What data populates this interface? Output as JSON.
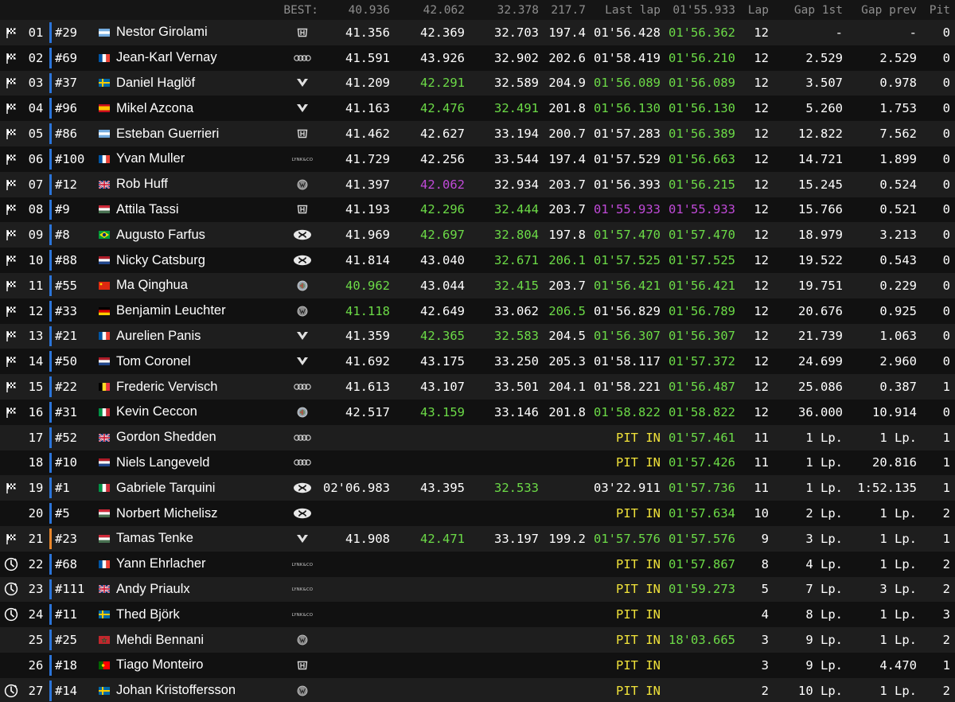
{
  "header": {
    "best_label": "BEST:",
    "best_s1": "40.936",
    "best_s2": "42.062",
    "best_s3": "32.378",
    "best_speed": "217.7",
    "last_lap_label": "Last lap",
    "best_lap": "01'55.933",
    "lap_label": "Lap",
    "gap_first_label": "Gap 1st",
    "gap_prev_label": "Gap prev",
    "pit_label": "Pit"
  },
  "colors": {
    "purple": "#c04ad8",
    "green": "#6cdb47",
    "yellow": "#f0e23a",
    "position_bar_blue": "#2a74d9",
    "position_bar_orange": "#e8862c"
  },
  "rows": [
    {
      "status": "checkered-flag-icon",
      "pos": "01",
      "num": "#29",
      "flag": "argentina",
      "name": "Nestor Girolami",
      "make": "honda-logo",
      "s1": "41.356",
      "s1c": "white",
      "s2": "42.369",
      "s2c": "white",
      "s3": "32.703",
      "s3c": "white",
      "spd": "197.4",
      "spdc": "white",
      "last": "01'56.428",
      "lastc": "white",
      "best": "01'56.362",
      "bestc": "green",
      "lap": "12",
      "gap1": "-",
      "gapp": "-",
      "pit": "0"
    },
    {
      "status": "checkered-flag-icon",
      "pos": "02",
      "num": "#69",
      "flag": "france",
      "name": "Jean-Karl Vernay",
      "make": "audi-logo",
      "s1": "41.591",
      "s1c": "white",
      "s2": "43.926",
      "s2c": "white",
      "s3": "32.902",
      "s3c": "white",
      "spd": "202.6",
      "spdc": "white",
      "last": "01'58.419",
      "lastc": "white",
      "best": "01'56.210",
      "bestc": "green",
      "lap": "12",
      "gap1": "2.529",
      "gapp": "2.529",
      "pit": "0"
    },
    {
      "status": "checkered-flag-icon",
      "pos": "03",
      "num": "#37",
      "flag": "sweden",
      "name": "Daniel Haglöf",
      "make": "cupra-logo",
      "s1": "41.209",
      "s1c": "white",
      "s2": "42.291",
      "s2c": "green",
      "s3": "32.589",
      "s3c": "white",
      "spd": "204.9",
      "spdc": "white",
      "last": "01'56.089",
      "lastc": "green",
      "best": "01'56.089",
      "bestc": "green",
      "lap": "12",
      "gap1": "3.507",
      "gapp": "0.978",
      "pit": "0"
    },
    {
      "status": "checkered-flag-icon",
      "pos": "04",
      "num": "#96",
      "flag": "spain",
      "name": "Mikel Azcona",
      "make": "cupra-logo",
      "s1": "41.163",
      "s1c": "white",
      "s2": "42.476",
      "s2c": "green",
      "s3": "32.491",
      "s3c": "green",
      "spd": "201.8",
      "spdc": "white",
      "last": "01'56.130",
      "lastc": "green",
      "best": "01'56.130",
      "bestc": "green",
      "lap": "12",
      "gap1": "5.260",
      "gapp": "1.753",
      "pit": "0"
    },
    {
      "status": "checkered-flag-icon",
      "pos": "05",
      "num": "#86",
      "flag": "argentina",
      "name": "Esteban Guerrieri",
      "make": "honda-logo",
      "s1": "41.462",
      "s1c": "white",
      "s2": "42.627",
      "s2c": "white",
      "s3": "33.194",
      "s3c": "white",
      "spd": "200.7",
      "spdc": "white",
      "last": "01'57.283",
      "lastc": "white",
      "best": "01'56.389",
      "bestc": "green",
      "lap": "12",
      "gap1": "12.822",
      "gapp": "7.562",
      "pit": "0"
    },
    {
      "status": "checkered-flag-icon",
      "pos": "06",
      "num": "#100",
      "flag": "france",
      "name": "Yvan Muller",
      "make": "lynkco-logo",
      "s1": "41.729",
      "s1c": "white",
      "s2": "42.256",
      "s2c": "white",
      "s3": "33.544",
      "s3c": "white",
      "spd": "197.4",
      "spdc": "white",
      "last": "01'57.529",
      "lastc": "white",
      "best": "01'56.663",
      "bestc": "green",
      "lap": "12",
      "gap1": "14.721",
      "gapp": "1.899",
      "pit": "0"
    },
    {
      "status": "checkered-flag-icon",
      "pos": "07",
      "num": "#12",
      "flag": "uk",
      "name": "Rob Huff",
      "make": "vw-logo",
      "s1": "41.397",
      "s1c": "white",
      "s2": "42.062",
      "s2c": "purple",
      "s3": "32.934",
      "s3c": "white",
      "spd": "203.7",
      "spdc": "white",
      "last": "01'56.393",
      "lastc": "white",
      "best": "01'56.215",
      "bestc": "green",
      "lap": "12",
      "gap1": "15.245",
      "gapp": "0.524",
      "pit": "0"
    },
    {
      "status": "checkered-flag-icon",
      "pos": "08",
      "num": "#9",
      "flag": "hungary",
      "name": "Attila Tassi",
      "make": "honda-logo",
      "s1": "41.193",
      "s1c": "white",
      "s2": "42.296",
      "s2c": "green",
      "s3": "32.444",
      "s3c": "green",
      "spd": "203.7",
      "spdc": "white",
      "last": "01'55.933",
      "lastc": "purple",
      "best": "01'55.933",
      "bestc": "purple",
      "lap": "12",
      "gap1": "15.766",
      "gapp": "0.521",
      "pit": "0"
    },
    {
      "status": "checkered-flag-icon",
      "pos": "09",
      "num": "#8",
      "flag": "brazil",
      "name": "Augusto Farfus",
      "make": "hyundai-logo",
      "s1": "41.969",
      "s1c": "white",
      "s2": "42.697",
      "s2c": "green",
      "s3": "32.804",
      "s3c": "green",
      "spd": "197.8",
      "spdc": "white",
      "last": "01'57.470",
      "lastc": "green",
      "best": "01'57.470",
      "bestc": "green",
      "lap": "12",
      "gap1": "18.979",
      "gapp": "3.213",
      "pit": "0"
    },
    {
      "status": "checkered-flag-icon",
      "pos": "10",
      "num": "#88",
      "flag": "netherlands",
      "name": "Nicky Catsburg",
      "make": "hyundai-logo",
      "s1": "41.814",
      "s1c": "white",
      "s2": "43.040",
      "s2c": "white",
      "s3": "32.671",
      "s3c": "green",
      "spd": "206.1",
      "spdc": "green",
      "last": "01'57.525",
      "lastc": "green",
      "best": "01'57.525",
      "bestc": "green",
      "lap": "12",
      "gap1": "19.522",
      "gapp": "0.543",
      "pit": "0"
    },
    {
      "status": "checkered-flag-icon",
      "pos": "11",
      "num": "#55",
      "flag": "china",
      "name": "Ma Qinghua",
      "make": "alfa-logo",
      "s1": "40.962",
      "s1c": "green",
      "s2": "43.044",
      "s2c": "white",
      "s3": "32.415",
      "s3c": "green",
      "spd": "203.7",
      "spdc": "white",
      "last": "01'56.421",
      "lastc": "green",
      "best": "01'56.421",
      "bestc": "green",
      "lap": "12",
      "gap1": "19.751",
      "gapp": "0.229",
      "pit": "0"
    },
    {
      "status": "checkered-flag-icon",
      "pos": "12",
      "num": "#33",
      "flag": "germany",
      "name": "Benjamin Leuchter",
      "make": "vw-logo",
      "s1": "41.118",
      "s1c": "green",
      "s2": "42.649",
      "s2c": "white",
      "s3": "33.062",
      "s3c": "white",
      "spd": "206.5",
      "spdc": "green",
      "last": "01'56.829",
      "lastc": "white",
      "best": "01'56.789",
      "bestc": "green",
      "lap": "12",
      "gap1": "20.676",
      "gapp": "0.925",
      "pit": "0"
    },
    {
      "status": "checkered-flag-icon",
      "pos": "13",
      "num": "#21",
      "flag": "france",
      "name": "Aurelien Panis",
      "make": "cupra-logo",
      "s1": "41.359",
      "s1c": "white",
      "s2": "42.365",
      "s2c": "green",
      "s3": "32.583",
      "s3c": "green",
      "spd": "204.5",
      "spdc": "white",
      "last": "01'56.307",
      "lastc": "green",
      "best": "01'56.307",
      "bestc": "green",
      "lap": "12",
      "gap1": "21.739",
      "gapp": "1.063",
      "pit": "0"
    },
    {
      "status": "checkered-flag-icon",
      "pos": "14",
      "num": "#50",
      "flag": "netherlands",
      "name": "Tom Coronel",
      "make": "cupra-logo",
      "s1": "41.692",
      "s1c": "white",
      "s2": "43.175",
      "s2c": "white",
      "s3": "33.250",
      "s3c": "white",
      "spd": "205.3",
      "spdc": "white",
      "last": "01'58.117",
      "lastc": "white",
      "best": "01'57.372",
      "bestc": "green",
      "lap": "12",
      "gap1": "24.699",
      "gapp": "2.960",
      "pit": "0"
    },
    {
      "status": "checkered-flag-icon",
      "pos": "15",
      "num": "#22",
      "flag": "belgium",
      "name": "Frederic Vervisch",
      "make": "audi-logo",
      "s1": "41.613",
      "s1c": "white",
      "s2": "43.107",
      "s2c": "white",
      "s3": "33.501",
      "s3c": "white",
      "spd": "204.1",
      "spdc": "white",
      "last": "01'58.221",
      "lastc": "white",
      "best": "01'56.487",
      "bestc": "green",
      "lap": "12",
      "gap1": "25.086",
      "gapp": "0.387",
      "pit": "1"
    },
    {
      "status": "checkered-flag-icon",
      "pos": "16",
      "num": "#31",
      "flag": "italy",
      "name": "Kevin Ceccon",
      "make": "alfa-logo",
      "s1": "42.517",
      "s1c": "white",
      "s2": "43.159",
      "s2c": "green",
      "s3": "33.146",
      "s3c": "white",
      "spd": "201.8",
      "spdc": "white",
      "last": "01'58.822",
      "lastc": "green",
      "best": "01'58.822",
      "bestc": "green",
      "lap": "12",
      "gap1": "36.000",
      "gapp": "10.914",
      "pit": "0"
    },
    {
      "status": "",
      "pos": "17",
      "num": "#52",
      "flag": "uk",
      "name": "Gordon Shedden",
      "make": "audi-logo",
      "s1": "",
      "s1c": "white",
      "s2": "",
      "s2c": "white",
      "s3": "",
      "s3c": "white",
      "spd": "",
      "spdc": "white",
      "last": "PIT IN",
      "lastc": "yellow",
      "best": "01'57.461",
      "bestc": "green",
      "lap": "11",
      "gap1": "1 Lp.",
      "gapp": "1 Lp.",
      "pit": "1"
    },
    {
      "status": "",
      "pos": "18",
      "num": "#10",
      "flag": "netherlands",
      "name": "Niels Langeveld",
      "make": "audi-logo",
      "s1": "",
      "s1c": "white",
      "s2": "",
      "s2c": "white",
      "s3": "",
      "s3c": "white",
      "spd": "",
      "spdc": "white",
      "last": "PIT IN",
      "lastc": "yellow",
      "best": "01'57.426",
      "bestc": "green",
      "lap": "11",
      "gap1": "1 Lp.",
      "gapp": "20.816",
      "pit": "1"
    },
    {
      "status": "checkered-flag-icon",
      "pos": "19",
      "num": "#1",
      "flag": "italy",
      "name": "Gabriele Tarquini",
      "make": "hyundai-logo",
      "s1": "02'06.983",
      "s1c": "white",
      "s2": "43.395",
      "s2c": "white",
      "s3": "32.533",
      "s3c": "green",
      "spd": "",
      "spdc": "white",
      "last": "03'22.911",
      "lastc": "white",
      "best": "01'57.736",
      "bestc": "green",
      "lap": "11",
      "gap1": "1 Lp.",
      "gapp": "1:52.135",
      "pit": "1"
    },
    {
      "status": "",
      "pos": "20",
      "num": "#5",
      "flag": "hungary",
      "name": "Norbert Michelisz",
      "make": "hyundai-logo",
      "s1": "",
      "s1c": "white",
      "s2": "",
      "s2c": "white",
      "s3": "",
      "s3c": "white",
      "spd": "",
      "spdc": "white",
      "last": "PIT IN",
      "lastc": "yellow",
      "best": "01'57.634",
      "bestc": "green",
      "lap": "10",
      "gap1": "2 Lp.",
      "gapp": "1 Lp.",
      "pit": "2"
    },
    {
      "status": "checkered-flag-icon",
      "pos": "21",
      "num": "#23",
      "flag": "hungary",
      "name": "Tamas Tenke",
      "make": "cupra-logo",
      "bar": "orange",
      "s1": "41.908",
      "s1c": "white",
      "s2": "42.471",
      "s2c": "green",
      "s3": "33.197",
      "s3c": "white",
      "spd": "199.2",
      "spdc": "white",
      "last": "01'57.576",
      "lastc": "green",
      "best": "01'57.576",
      "bestc": "green",
      "lap": "9",
      "gap1": "3 Lp.",
      "gapp": "1 Lp.",
      "pit": "1"
    },
    {
      "status": "retired-icon",
      "pos": "22",
      "num": "#68",
      "flag": "france",
      "name": "Yann Ehrlacher",
      "make": "lynkco-logo",
      "s1": "",
      "s1c": "white",
      "s2": "",
      "s2c": "white",
      "s3": "",
      "s3c": "white",
      "spd": "",
      "spdc": "white",
      "last": "PIT IN",
      "lastc": "yellow",
      "best": "01'57.867",
      "bestc": "green",
      "lap": "8",
      "gap1": "4 Lp.",
      "gapp": "1 Lp.",
      "pit": "2"
    },
    {
      "status": "retired-icon",
      "pos": "23",
      "num": "#111",
      "flag": "uk",
      "name": "Andy Priaulx",
      "make": "lynkco-logo",
      "s1": "",
      "s1c": "white",
      "s2": "",
      "s2c": "white",
      "s3": "",
      "s3c": "white",
      "spd": "",
      "spdc": "white",
      "last": "PIT IN",
      "lastc": "yellow",
      "best": "01'59.273",
      "bestc": "green",
      "lap": "5",
      "gap1": "7 Lp.",
      "gapp": "3 Lp.",
      "pit": "2"
    },
    {
      "status": "retired-icon",
      "pos": "24",
      "num": "#11",
      "flag": "sweden",
      "name": "Thed Björk",
      "make": "lynkco-logo",
      "s1": "",
      "s1c": "white",
      "s2": "",
      "s2c": "white",
      "s3": "",
      "s3c": "white",
      "spd": "",
      "spdc": "white",
      "last": "PIT IN",
      "lastc": "yellow",
      "best": "",
      "bestc": "green",
      "lap": "4",
      "gap1": "8 Lp.",
      "gapp": "1 Lp.",
      "pit": "3"
    },
    {
      "status": "",
      "pos": "25",
      "num": "#25",
      "flag": "morocco",
      "name": "Mehdi Bennani",
      "make": "vw-logo",
      "s1": "",
      "s1c": "white",
      "s2": "",
      "s2c": "white",
      "s3": "",
      "s3c": "white",
      "spd": "",
      "spdc": "white",
      "last": "PIT IN",
      "lastc": "yellow",
      "best": "18'03.665",
      "bestc": "green",
      "lap": "3",
      "gap1": "9 Lp.",
      "gapp": "1 Lp.",
      "pit": "2"
    },
    {
      "status": "",
      "pos": "26",
      "num": "#18",
      "flag": "portugal",
      "name": "Tiago Monteiro",
      "make": "honda-logo",
      "s1": "",
      "s1c": "white",
      "s2": "",
      "s2c": "white",
      "s3": "",
      "s3c": "white",
      "spd": "",
      "spdc": "white",
      "last": "PIT IN",
      "lastc": "yellow",
      "best": "",
      "bestc": "green",
      "lap": "3",
      "gap1": "9 Lp.",
      "gapp": "4.470",
      "pit": "1"
    },
    {
      "status": "retired-icon",
      "pos": "27",
      "num": "#14",
      "flag": "sweden",
      "name": "Johan Kristoffersson",
      "make": "vw-logo",
      "s1": "",
      "s1c": "white",
      "s2": "",
      "s2c": "white",
      "s3": "",
      "s3c": "white",
      "spd": "",
      "spdc": "white",
      "last": "PIT IN",
      "lastc": "yellow",
      "best": "",
      "bestc": "green",
      "lap": "2",
      "gap1": "10 Lp.",
      "gapp": "1 Lp.",
      "pit": "2"
    }
  ]
}
